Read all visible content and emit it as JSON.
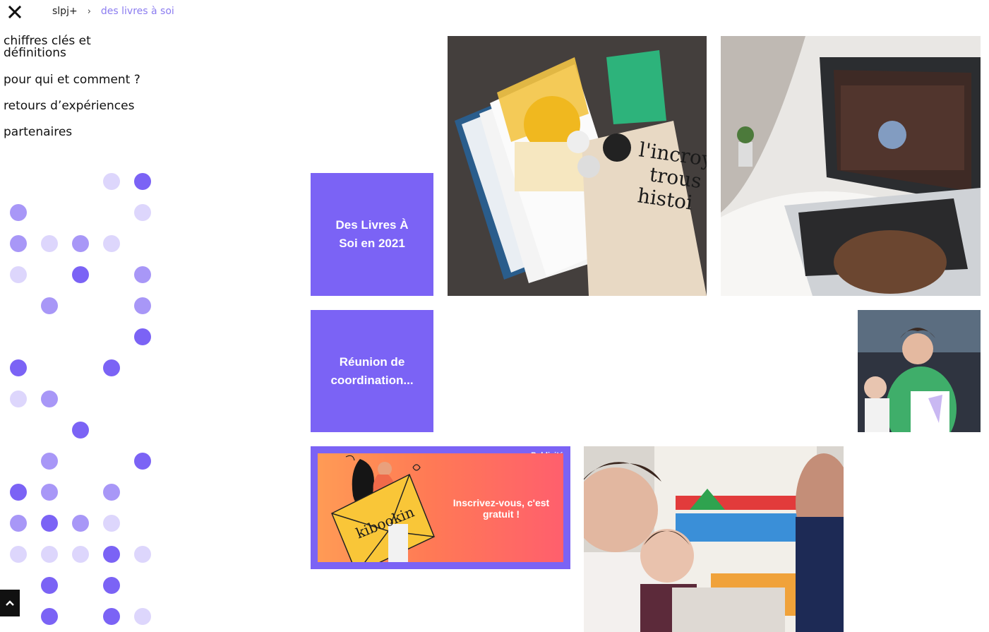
{
  "header": {
    "close_icon": "close-icon",
    "breadcrumb": {
      "root": "slpj+",
      "separator": "›",
      "current": "des livres à soi"
    }
  },
  "sidebar": {
    "items": [
      {
        "label": "chiffres clés et\ndéfinitions"
      },
      {
        "label": "pour qui et comment ?"
      },
      {
        "label": "retours d’expériences"
      },
      {
        "label": "partenaires"
      }
    ]
  },
  "main": {
    "tiles": [
      {
        "label": "Des Livres À Soi en 2021"
      },
      {
        "label": "Réunion de coordination..."
      }
    ],
    "ad": {
      "badge": "Publicité",
      "brand": "kibookin",
      "cta": "Inscrivez-vous, c'est gratuit !"
    }
  },
  "colors": {
    "accent": "#7b63f5",
    "accent_light": "#a897f7",
    "accent_pale": "#ddd6fc",
    "breadcrumb_current": "#8b7cf0"
  },
  "scroll_top": {
    "icon": "chevron-up-icon"
  }
}
